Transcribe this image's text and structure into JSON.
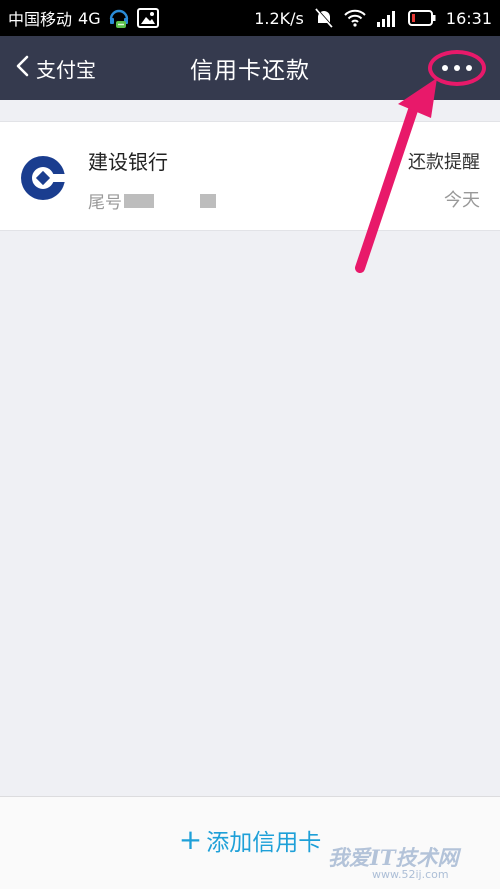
{
  "status_bar": {
    "carrier": "中国移动",
    "network": "4G",
    "speed": "1.2K/s",
    "time": "16:31"
  },
  "nav": {
    "back_label": "支付宝",
    "title": "信用卡还款",
    "more_icon": "more-dots-icon"
  },
  "cards": [
    {
      "bank_name": "建设银行",
      "tail_label": "尾号",
      "reminder_label": "还款提醒",
      "reminder_value": "今天",
      "brand_color": "#1a3d8f"
    }
  ],
  "bottom": {
    "add_label": "添加信用卡"
  },
  "colors": {
    "nav_bg": "#353a4e",
    "accent": "#1ea0d8",
    "annotation": "#e8196a"
  },
  "watermark": {
    "text": "我爱IT技术网",
    "url": "www.52ij.com"
  }
}
